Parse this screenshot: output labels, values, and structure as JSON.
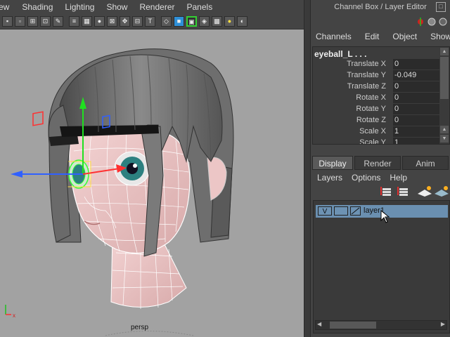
{
  "viewport": {
    "menu": [
      "ew",
      "Shading",
      "Lighting",
      "Show",
      "Renderer",
      "Panels"
    ],
    "camera_label": "persp",
    "axis_labels": {
      "x": "x",
      "y": "y"
    }
  },
  "panel": {
    "title": "Channel Box / Layer Editor",
    "channel_menu": [
      "Channels",
      "Edit",
      "Object",
      "Show"
    ],
    "object_name": "eyeball_L . . .",
    "attributes": [
      {
        "name": "Translate X",
        "value": "0"
      },
      {
        "name": "Translate Y",
        "value": "-0.049"
      },
      {
        "name": "Translate Z",
        "value": "0"
      },
      {
        "name": "Rotate X",
        "value": "0"
      },
      {
        "name": "Rotate Y",
        "value": "0"
      },
      {
        "name": "Rotate Z",
        "value": "0"
      },
      {
        "name": "Scale X",
        "value": "1"
      },
      {
        "name": "Scale Y",
        "value": "1"
      }
    ],
    "tabs": [
      "Display",
      "Render",
      "Anim"
    ],
    "active_tab": "Display",
    "layer_menu": [
      "Layers",
      "Options",
      "Help"
    ],
    "layers": [
      {
        "visible": "V",
        "name": "layer1"
      }
    ]
  },
  "colors": {
    "viewport_bg": "#a2a2a2",
    "panel_bg": "#444444",
    "selection": "#6a8fb0",
    "axis_x": "#ff3030",
    "axis_y": "#20e020",
    "axis_z": "#3060ff"
  }
}
